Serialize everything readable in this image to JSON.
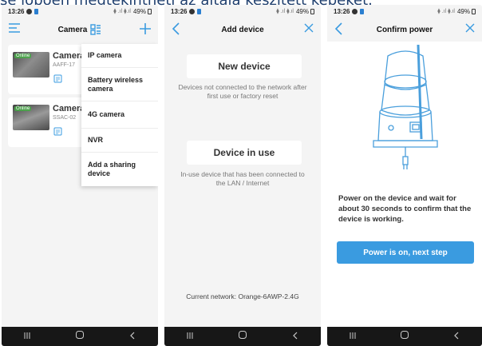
{
  "banner": {
    "text": "sé lóboen megtekintheti az általa készített képeket."
  },
  "status_bar": {
    "time": "13:26",
    "battery": "49%",
    "signal": "⧫ .ıl ⧫.ıl"
  },
  "screen1": {
    "title": "Camera",
    "cameras": [
      {
        "name": "Camera",
        "id": "AAFF-17",
        "status": "Online"
      },
      {
        "name": "Camera",
        "id": "SSAC-02",
        "status": "Online"
      }
    ],
    "menu": [
      {
        "label": "IP camera"
      },
      {
        "label": "Battery wireless camera"
      },
      {
        "label": "4G camera"
      },
      {
        "label": "NVR"
      },
      {
        "label": "Add a sharing device"
      }
    ]
  },
  "screen2": {
    "title": "Add device",
    "new_device": {
      "label": "New device",
      "desc": "Devices not connected to the network after first use or factory reset"
    },
    "device_in_use": {
      "label": "Device in use",
      "desc": "In-use device that has been connected to the LAN / Internet"
    },
    "current_network": "Current network: Orange-6AWP-2.4G"
  },
  "screen3": {
    "title": "Confirm power",
    "instruction": "Power on the device and wait for about 30 seconds to confirm that the device is working.",
    "next_button": "Power is on, next step"
  },
  "colors": {
    "accent": "#3a9be0",
    "nav_bar": "#171717",
    "illustration": "#4a9fdc",
    "online": "#46aa46"
  },
  "icons": {
    "menu": "hamburger-icon",
    "grid": "grid-icon",
    "add": "plus-icon",
    "back": "chevron-left-icon",
    "close": "close-icon",
    "file": "document-icon",
    "nav_recents": "recents-icon",
    "nav_home": "home-icon",
    "nav_back": "back-icon"
  }
}
